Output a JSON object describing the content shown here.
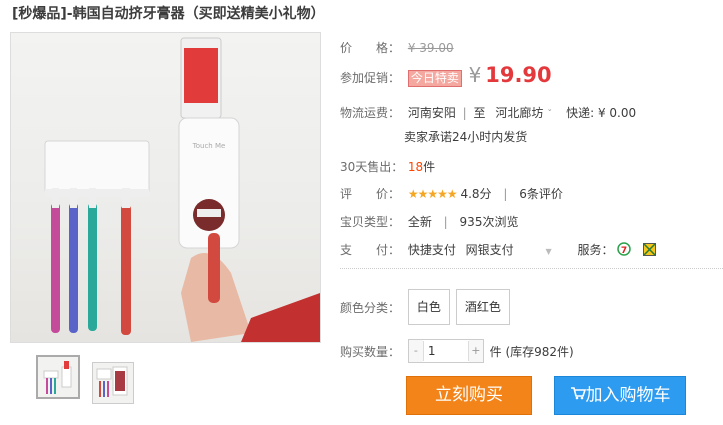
{
  "product": {
    "title": "[秒爆品]-韩国自动挤牙膏器（买即送精美小礼物）"
  },
  "image": {
    "device_label": "Touch Me",
    "thumbnail_count": 2
  },
  "price": {
    "label": "价　　格：",
    "original": "¥ 39.00"
  },
  "promo": {
    "label": "参加促销：",
    "tag": "今日特卖",
    "currency": "¥",
    "price": "19.90"
  },
  "shipping": {
    "label": "物流运费：",
    "from": "河南安阳",
    "separator": "|",
    "to_word": "至",
    "dest": "河北廊坊",
    "dest_arrow": "ˇ",
    "express": "快递:",
    "fee": "¥ 0.00",
    "promise": "卖家承诺24小时内发货"
  },
  "sales": {
    "label": "30天售出：",
    "count": "18",
    "unit": "件"
  },
  "rating": {
    "label": "评　　价：",
    "stars": "★★★★★",
    "score": "4.8分",
    "separator": "|",
    "reviews": "6条评价"
  },
  "item_type": {
    "label": "宝贝类型：",
    "condition": "全新",
    "separator": "|",
    "views": "935次浏览"
  },
  "payment": {
    "label": "支　　付：",
    "methods": [
      "快捷支付",
      "网银支付"
    ],
    "more_arrow": "▼",
    "service_label": "服务："
  },
  "color": {
    "label": "颜色分类：",
    "options": [
      "白色",
      "酒红色"
    ]
  },
  "quantity": {
    "label": "购买数量：",
    "minus": "-",
    "value": "1",
    "plus": "+",
    "stock": "件 (库存982件)"
  },
  "actions": {
    "buy_now": "立刻购买",
    "add_cart": "加入购物车",
    "cart_icon": "cart-icon"
  },
  "colors": {
    "accent_price": "#e4393c",
    "buy_button": "#f28419",
    "cart_button": "#2d9cf0",
    "promo_tag": "#f4a8a0"
  }
}
